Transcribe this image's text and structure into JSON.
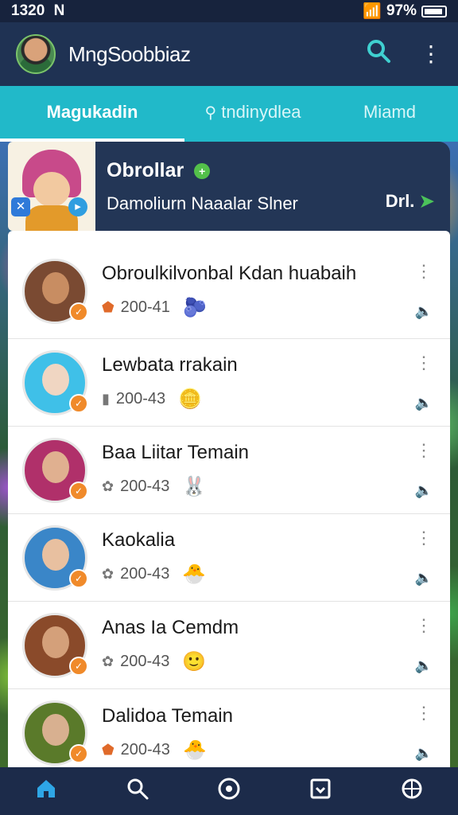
{
  "status": {
    "time": "1320",
    "carrier_mark": "N",
    "battery": "97%"
  },
  "appbar": {
    "title": "MngSoobbiaz"
  },
  "tabs": [
    {
      "label": "Magukadin",
      "active": true
    },
    {
      "label": "tndinydlea",
      "active": false
    },
    {
      "label": "Miamd",
      "active": false
    }
  ],
  "featured": {
    "title": "Obrollar",
    "subtitle": "Damoliurn Naaalar Slner",
    "tag": "Drl."
  },
  "chats": [
    {
      "name": "Obroulkilvonbal Kdan huabaih",
      "meta": "200-41",
      "meta_icon": "shield-icon",
      "sticker": "🫐"
    },
    {
      "name": "Lewbata rrakain",
      "meta": "200-43",
      "meta_icon": "chat-icon",
      "sticker": "🪙"
    },
    {
      "name": "Baa Liitar Temain",
      "meta": "200-43",
      "meta_icon": "gear-icon",
      "sticker": "🐰"
    },
    {
      "name": "Kaokalia",
      "meta": "200-43",
      "meta_icon": "gear-icon",
      "sticker": "🐣"
    },
    {
      "name": "Anas Ia Cemdm",
      "meta": "200-43",
      "meta_icon": "gear-icon",
      "sticker": "🙂"
    },
    {
      "name": "Dalidoa Temain",
      "meta": "200-43",
      "meta_icon": "shield-icon",
      "sticker": "🐣"
    }
  ],
  "colors": {
    "accent": "#21b9c9",
    "appbar": "#1f3253",
    "nav_active": "#2ea6e6",
    "badge": "#f08a2a"
  }
}
